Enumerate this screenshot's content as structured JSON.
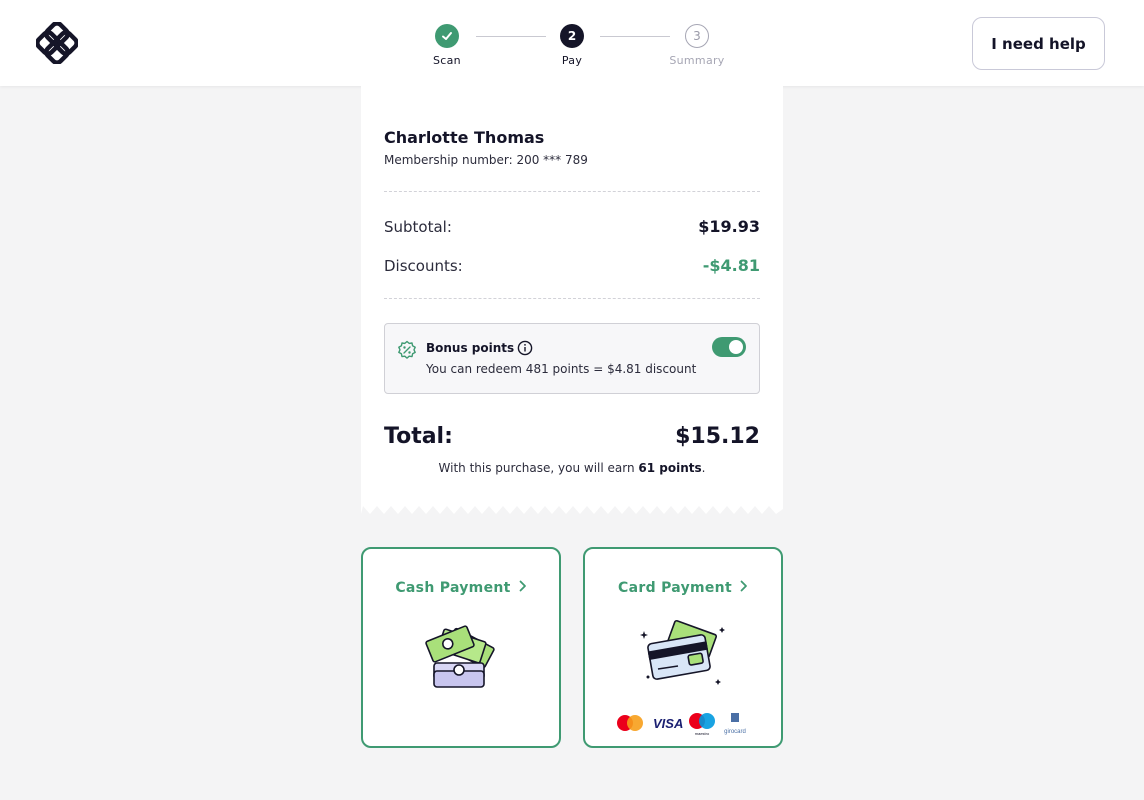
{
  "header": {
    "logo_icon": "clover-logo-icon",
    "help_label": "I need help",
    "steps": [
      {
        "number": "",
        "label": "Scan",
        "state": "done"
      },
      {
        "number": "2",
        "label": "Pay",
        "state": "active"
      },
      {
        "number": "3",
        "label": "Summary",
        "state": "pending"
      }
    ]
  },
  "receipt": {
    "customer_name": "Charlotte Thomas",
    "membership": "Membership number: 200 *** 789",
    "subtotal_label": "Subtotal:",
    "subtotal_value": "$19.93",
    "discounts_label": "Discounts:",
    "discounts_value": "-$4.81",
    "bonus": {
      "title": "Bonus points",
      "description": "You can redeem 481 points = $4.81 discount",
      "enabled": true
    },
    "total_label": "Total:",
    "total_value": "$15.12",
    "earn_prefix": "With this purchase, you will earn ",
    "earn_points": "61 points",
    "earn_suffix": "."
  },
  "payments": {
    "cash_label": "Cash Payment",
    "card_label": "Card Payment",
    "card_brands": [
      "mastercard",
      "VISA",
      "maestro",
      "girocard"
    ]
  },
  "colors": {
    "accent": "#3f9a72",
    "dark": "#151528",
    "background": "#f4f4f5"
  }
}
